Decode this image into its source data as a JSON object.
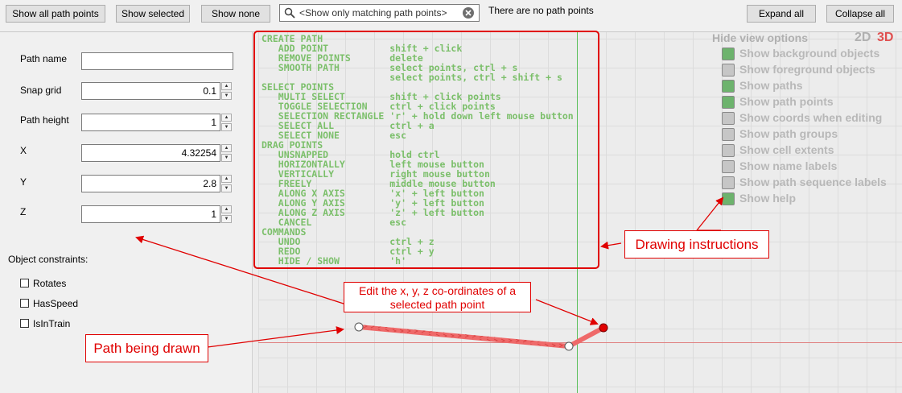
{
  "toolbar": {
    "show_all": "Show all path points",
    "show_selected": "Show selected",
    "show_none": "Show none",
    "search_placeholder": "<Show only matching path points>",
    "status": "There are no path points",
    "expand_all": "Expand all",
    "collapse_all": "Collapse all"
  },
  "properties": {
    "path_name_label": "Path name",
    "path_name_value": "",
    "snap_grid_label": "Snap grid",
    "snap_grid_value": "0.1",
    "path_height_label": "Path height",
    "path_height_value": "1",
    "x_label": "X",
    "x_value": "4.32254",
    "y_label": "Y",
    "y_value": "2.8",
    "z_label": "Z",
    "z_value": "1",
    "constraints_label": "Object constraints:",
    "rotates": "Rotates",
    "hasspeed": "HasSpeed",
    "isintrain": "IsInTrain"
  },
  "help_text": "CREATE PATH\n   ADD POINT           shift + click\n   REMOVE POINTS       delete\n   SMOOTH PATH         select points, ctrl + s\n                       select points, ctrl + shift + s\nSELECT POINTS\n   MULTI SELECT        shift + click points\n   TOGGLE SELECTION    ctrl + click points\n   SELECTION RECTANGLE 'r' + hold down left mouse button\n   SELECT ALL          ctrl + a\n   SELECT NONE         esc\nDRAG POINTS\n   UNSNAPPED           hold ctrl\n   HORIZONTALLY        left mouse button\n   VERTICALLY          right mouse button\n   FREELY              middle mouse button\n   ALONG X AXIS        'x' + left button\n   ALONG Y AXIS        'y' + left button\n   ALONG Z AXIS        'z' + left button\n   CANCEL              esc\nCOMMANDS\n   UNDO                ctrl + z\n   REDO                ctrl + y\n   HIDE / SHOW         'h'",
  "view_options": {
    "title": "Hide view options",
    "mode_2d": "2D",
    "mode_3d": "3D",
    "options": [
      {
        "label": "Show background objects",
        "checked": true
      },
      {
        "label": "Show foreground objects",
        "checked": false
      },
      {
        "label": "Show paths",
        "checked": true
      },
      {
        "label": "Show path points",
        "checked": true
      },
      {
        "label": "Show coords when editing",
        "checked": false
      },
      {
        "label": "Show path groups",
        "checked": false
      },
      {
        "label": "Show cell extents",
        "checked": false
      },
      {
        "label": "Show name labels",
        "checked": false
      },
      {
        "label": "Show path sequence labels",
        "checked": false
      },
      {
        "label": "Show help",
        "checked": true
      }
    ]
  },
  "annotations": {
    "drawing_instructions": "Drawing instructions",
    "edit_coords_line1": "Edit the x, y, z co-ordinates of a",
    "edit_coords_line2": "selected path point",
    "path_being_drawn": "Path being drawn"
  },
  "colors": {
    "annotation_red": "#e00000",
    "checked_green": "#6db36d",
    "unchecked_gray": "#c6c6c6",
    "help_green": "#7bbf6a"
  }
}
